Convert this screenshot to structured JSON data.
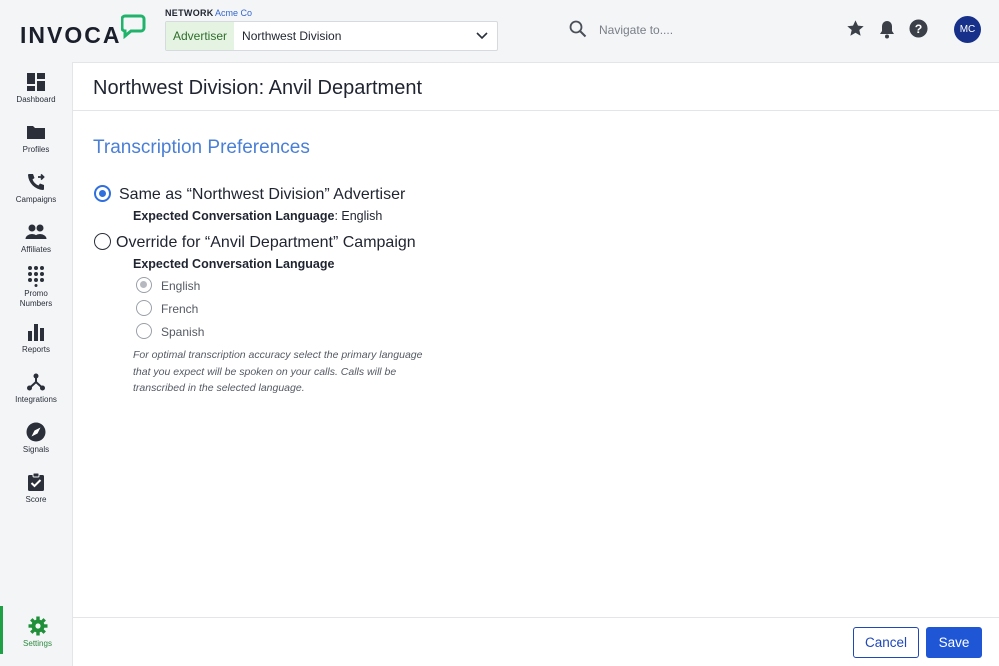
{
  "header": {
    "logo_text": "INVOCA",
    "network_label": "NETWORK",
    "network_value": "Acme Co",
    "advertiser_tag": "Advertiser",
    "advertiser_value": "Northwest Division",
    "search_placeholder": "Navigate to....",
    "avatar_initials": "MC"
  },
  "sidebar": {
    "items": [
      {
        "label": "Dashboard",
        "icon": "dashboard-icon"
      },
      {
        "label": "Profiles",
        "icon": "folder-icon"
      },
      {
        "label": "Campaigns",
        "icon": "phone-forward-icon"
      },
      {
        "label": "Affiliates",
        "icon": "people-icon"
      },
      {
        "label": "Promo",
        "label2": "Numbers",
        "icon": "dialpad-icon"
      },
      {
        "label": "Reports",
        "icon": "bar-chart-icon"
      },
      {
        "label": "Integrations",
        "icon": "integrations-icon"
      },
      {
        "label": "Signals",
        "icon": "compass-icon"
      },
      {
        "label": "Score",
        "icon": "clipboard-check-icon"
      },
      {
        "label": "Settings",
        "icon": "gear-icon",
        "active": true
      }
    ]
  },
  "main": {
    "page_title": "Northwest Division: Anvil Department",
    "section_title": "Transcription Preferences",
    "option_same": {
      "label": "Same as “Northwest Division” Advertiser",
      "sub_label": "Expected Conversation Language",
      "sub_value": ": English",
      "selected": true
    },
    "option_override": {
      "label": "Override for “Anvil Department” Campaign",
      "sub_label": "Expected Conversation Language",
      "selected": false
    },
    "languages": [
      {
        "label": "English",
        "selected": true
      },
      {
        "label": "French",
        "selected": false
      },
      {
        "label": "Spanish",
        "selected": false
      }
    ],
    "helper_text": "For optimal transcription accuracy select the primary language that you expect will be spoken on your calls. Calls will be transcribed in the selected language."
  },
  "footer": {
    "cancel_label": "Cancel",
    "save_label": "Save"
  },
  "colors": {
    "accent_blue": "#1f56d6",
    "section_title": "#4a7fd6",
    "brand_green": "#1fa045",
    "avatar": "#17318a"
  }
}
